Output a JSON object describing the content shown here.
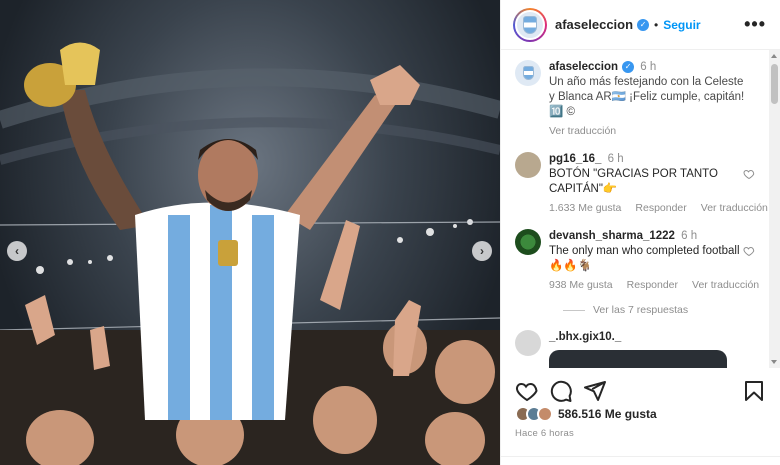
{
  "post": {
    "username": "afaseleccion",
    "follow_label": "Seguir",
    "separator": "•",
    "more_label": "•••"
  },
  "caption": {
    "username": "afaseleccion",
    "time": "6 h",
    "text": "Un año más festejando con la Celeste y Blanca AR🇦🇷 ¡Feliz cumple, capitán! 🔟 ©",
    "translate": "Ver traducción"
  },
  "comments": [
    {
      "username": "pg16_16_",
      "time": "6 h",
      "text": "BOTÓN \"GRACIAS POR TANTO CAPITÁN\"👉",
      "likes": "1.633 Me gusta",
      "reply": "Responder",
      "translate": "Ver traducción"
    },
    {
      "username": "devansh_sharma_1222",
      "time": "6 h",
      "text": "The only man who completed football 🔥🔥🐐",
      "likes": "938 Me gusta",
      "reply": "Responder",
      "translate": "Ver traducción"
    },
    {
      "username": "_.bhx.gix10._"
    }
  ],
  "replies_label": "Ver las 7 respuestas",
  "footer": {
    "likes": "586.516 Me gusta",
    "time_ago": "Hace 6 horas"
  },
  "colors": {
    "accent": "#0095f6",
    "verified": "#3897f0",
    "argentina_blue": "#74acdf"
  },
  "icons": [
    "heart-icon",
    "comment-icon",
    "share-icon",
    "save-icon",
    "verified-icon",
    "more-icon",
    "chevron-left-icon",
    "chevron-right-icon"
  ]
}
